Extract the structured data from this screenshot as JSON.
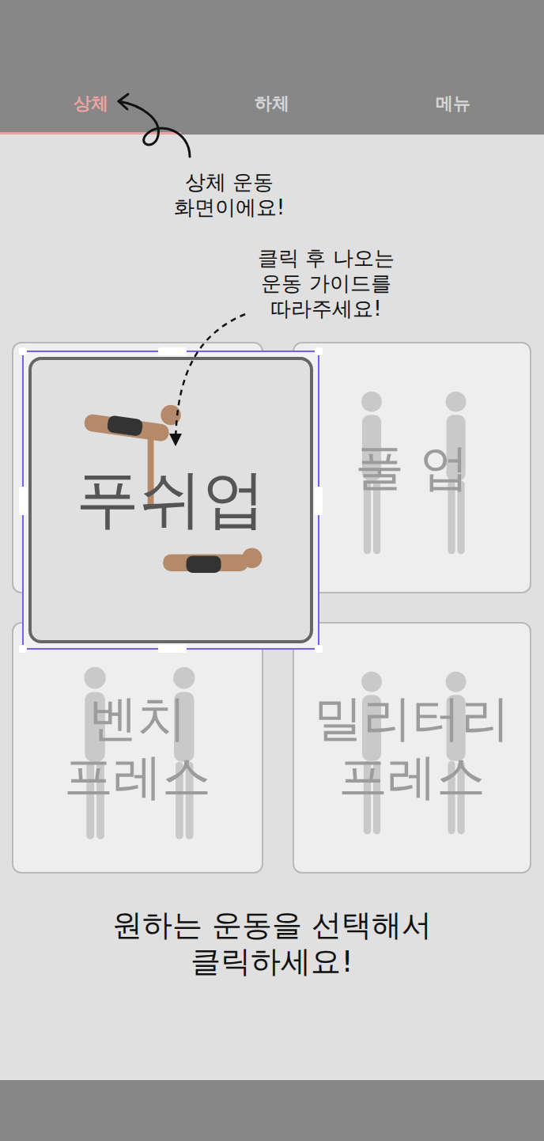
{
  "tabs": [
    {
      "label": "상체",
      "selected": true
    },
    {
      "label": "하체",
      "selected": false
    },
    {
      "label": "메뉴",
      "selected": false
    }
  ],
  "annotations": {
    "tab_hint": "상체 운동\n화면이에요!",
    "card_hint": "클릭 후 나오는\n운동 가이드를\n따라주세요!"
  },
  "exercises": [
    {
      "name": "푸쉬업",
      "selected": true
    },
    {
      "name": "풀 업",
      "selected": false
    },
    {
      "name": "벤치\n프레스",
      "selected": false
    },
    {
      "name": "밀리터리\n프레스",
      "selected": false
    }
  ],
  "instruction": "원하는 운동을 선택해서\n클릭하세요!"
}
